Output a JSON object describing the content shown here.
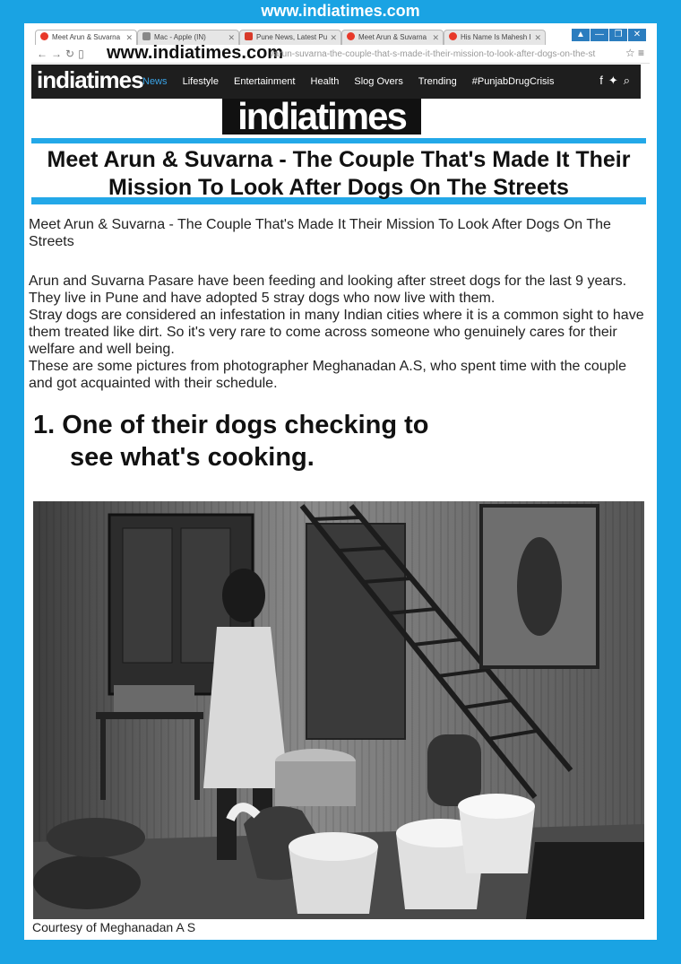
{
  "frame": {
    "url_label": "www.indiatimes.com"
  },
  "browser": {
    "tabs": [
      {
        "label": "Meet Arun & Suvarna",
        "color": "#e8392a",
        "active": true
      },
      {
        "label": "Mac - Apple (IN)",
        "color": "#888888",
        "active": false
      },
      {
        "label": "Pune News, Latest Pu",
        "color": "#d83a2a",
        "active": false
      },
      {
        "label": "Meet Arun & Suvarna",
        "color": "#e8392a",
        "active": false
      },
      {
        "label": "His Name Is Mahesh I",
        "color": "#e8392a",
        "active": false
      }
    ],
    "address_domain": "www.indiatimes.com",
    "address_path": "/arun-suvarna-the-couple-that-s-made-it-their-mission-to-look-after-dogs-on-the-st"
  },
  "site": {
    "logo": "indiatimes",
    "nav": [
      "News",
      "Lifestyle",
      "Entertainment",
      "Health",
      "Slog Overs",
      "Trending",
      "#PunjabDrugCrisis"
    ],
    "big_logo": "indiatimes"
  },
  "article": {
    "title_line1": "Meet Arun & Suvarna - The Couple That's Made It Their",
    "title_line2": "Mission To Look After Dogs On The Streets",
    "intro": "Meet Arun & Suvarna - The Couple That's Made It Their Mission To Look After Dogs On The Streets",
    "body_lines": [
      "Arun and Suvarna Pasare have been feeding and looking after street dogs for the last 9 years. They live in Pune and have adopted 5 stray dogs who now live with them.",
      "Stray dogs are considered an infestation in many Indian cities where it is a common sight to have them treated like dirt. So it's very rare to come across someone who genuinely cares for their welfare and well being.",
      "These are some pictures from photographer Meghanadan A.S, who spent time with the couple and got acquainted with their schedule."
    ],
    "heading_line1": "1. One of their dogs checking to",
    "heading_line2": "see what's cooking.",
    "caption": "Courtesy of Meghanadan A S"
  },
  "colors": {
    "frame_blue": "#1aa3e3",
    "nav_dark": "#1e1e1e",
    "news_blue": "#3aa3e6"
  }
}
